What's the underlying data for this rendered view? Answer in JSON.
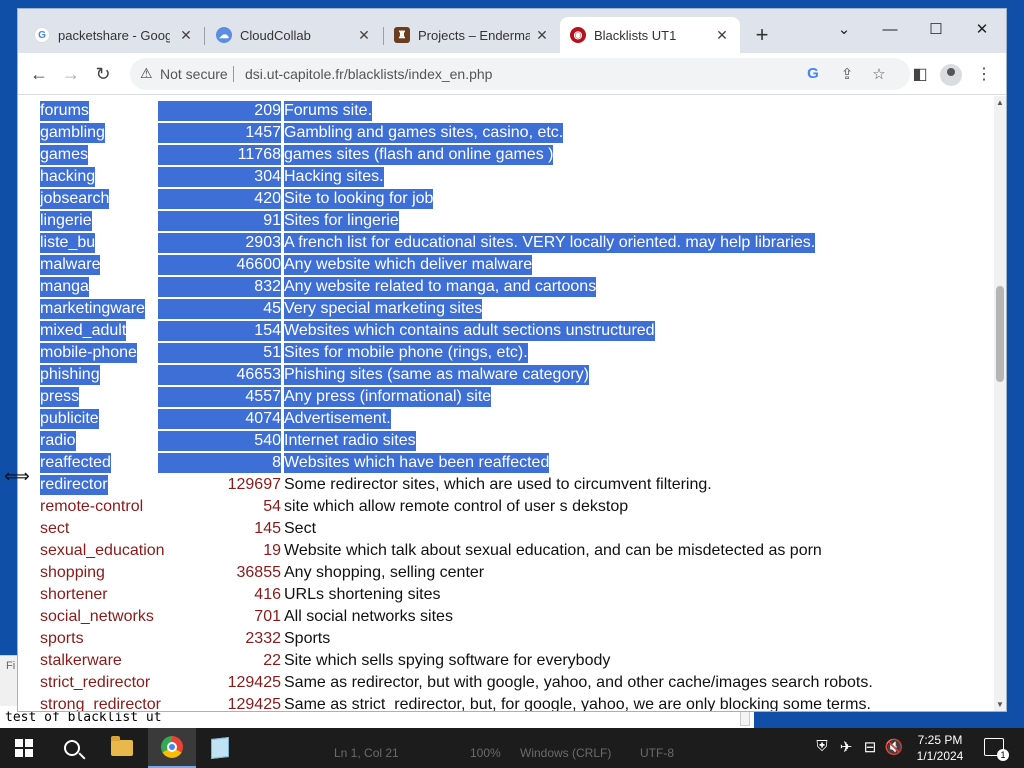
{
  "browser": {
    "tabs": [
      {
        "title": "packetshare - Google",
        "active": false
      },
      {
        "title": "CloudCollab",
        "active": false
      },
      {
        "title": "Projects – Enderman",
        "active": false
      },
      {
        "title": "Blacklists UT1",
        "active": true
      }
    ],
    "security_label": "Not secure",
    "url": "dsi.ut-capitole.fr/blacklists/index_en.php"
  },
  "blacklist_rows": [
    {
      "category": "forums",
      "count": "209",
      "description": "Forums site.",
      "selected": true
    },
    {
      "category": "gambling",
      "count": "1457",
      "description": "Gambling and games sites, casino, etc.",
      "selected": true
    },
    {
      "category": "games",
      "count": "11768",
      "description": "games sites (flash and online games )",
      "selected": true
    },
    {
      "category": "hacking",
      "count": "304",
      "description": "Hacking sites.",
      "selected": true
    },
    {
      "category": "jobsearch",
      "count": "420",
      "description": "Site to looking for job",
      "selected": true
    },
    {
      "category": "lingerie",
      "count": "91",
      "description": "Sites for lingerie",
      "selected": true
    },
    {
      "category": "liste_bu",
      "count": "2903",
      "description": "A french list for educational sites. VERY locally oriented. may help libraries.",
      "selected": true
    },
    {
      "category": "malware",
      "count": "46600",
      "description": "Any website which deliver malware",
      "selected": true
    },
    {
      "category": "manga",
      "count": "832",
      "description": "Any website related to manga, and cartoons",
      "selected": true
    },
    {
      "category": "marketingware",
      "count": "45",
      "description": "Very special marketing sites",
      "selected": true
    },
    {
      "category": "mixed_adult",
      "count": "154",
      "description": "Websites which contains adult sections unstructured",
      "selected": true
    },
    {
      "category": "mobile-phone",
      "count": "51",
      "description": "Sites for mobile phone (rings, etc).",
      "selected": true
    },
    {
      "category": "phishing",
      "count": "46653",
      "description": "Phishing sites (same as malware category)",
      "selected": true
    },
    {
      "category": "press",
      "count": "4557",
      "description": "Any press (informational) site",
      "selected": true
    },
    {
      "category": "publicite",
      "count": "4074",
      "description": "Advertisement.",
      "selected": true
    },
    {
      "category": "radio",
      "count": "540",
      "description": "Internet radio sites",
      "selected": true
    },
    {
      "category": "reaffected",
      "count": "8",
      "description": "Websites which have been reaffected",
      "selected": true
    },
    {
      "category": "redirector",
      "count": "129697",
      "description": "Some redirector sites, which are used to circumvent filtering.",
      "selected": "category"
    },
    {
      "category": "remote-control",
      "count": "54",
      "description": "site which allow remote control of user s dekstop",
      "selected": false
    },
    {
      "category": "sect",
      "count": "145",
      "description": "Sect",
      "selected": false
    },
    {
      "category": "sexual_education",
      "count": "19",
      "description": "Website which talk about sexual education, and can be misdetected as porn",
      "selected": false
    },
    {
      "category": "shopping",
      "count": "36855",
      "description": "Any shopping, selling center",
      "selected": false
    },
    {
      "category": "shortener",
      "count": "416",
      "description": "URLs shortening sites",
      "selected": false
    },
    {
      "category": "social_networks",
      "count": "701",
      "description": "All social networks sites",
      "selected": false
    },
    {
      "category": "sports",
      "count": "2332",
      "description": "Sports",
      "selected": false
    },
    {
      "category": "stalkerware",
      "count": "22",
      "description": "Site which sells spying software for everybody",
      "selected": false
    },
    {
      "category": "strict_redirector",
      "count": "129425",
      "description": "Same as redirector, but with google, yahoo, and other cache/images search robots.",
      "selected": false
    },
    {
      "category": "strong_redirector",
      "count": "129425",
      "description": "Same as strict_redirector, but, for google, yahoo, we are only blocking some terms.",
      "selected": false
    }
  ],
  "notepad": {
    "text": "test of blacklist ut",
    "status": {
      "position": "Ln 1, Col 21",
      "zoom": "100%",
      "line_ending": "Windows (CRLF)",
      "encoding": "UTF-8"
    }
  },
  "taskbar": {
    "clock_time": "7:25 PM",
    "clock_date": "1/1/2024",
    "notification_count": "1"
  },
  "colors": {
    "link": "#8b1a1a",
    "selection": "#3d6fd6",
    "desktop": "#0f4fa8"
  }
}
